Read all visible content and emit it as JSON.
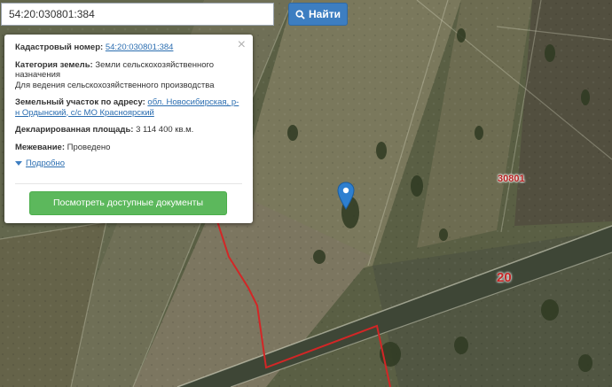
{
  "search": {
    "query": "54:20:030801:384",
    "button_label": "Найти"
  },
  "popup": {
    "cadastral_label": "Кадастровый номер:",
    "cadastral_value": "54:20:030801:384",
    "category_label": "Категория земель:",
    "category_value": "Земли сельскохозяйственного назначения",
    "usage_value": "Для ведения сельскохозяйственного производства",
    "address_label": "Земельный участок по адресу:",
    "address_value": "обл. Новосибирская, р-н Ордынский, с/с МО Красноярский",
    "area_label": "Декларированная площадь:",
    "area_value": "3 114 400 кв.м.",
    "survey_label": "Межевание:",
    "survey_value": "Проведено",
    "more_label": "Подробно",
    "docs_button": "Посмотреть доступные документы",
    "close_symbol": "×"
  },
  "map": {
    "quarter_label": "30801",
    "road_label": "20",
    "parcel_boundary_color": "#d32626",
    "marker_color": "#2d7fd0"
  }
}
